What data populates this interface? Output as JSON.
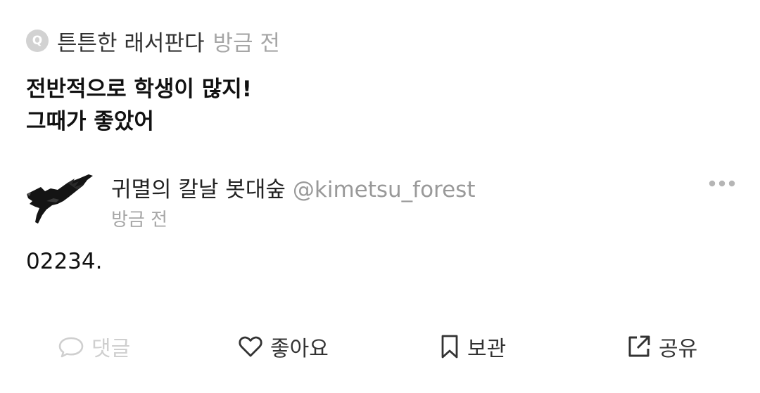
{
  "question": {
    "badge": "Q",
    "asker": "튼튼한 래서판다",
    "time": "방금 전",
    "lines": [
      "전반적으로 학생이 많지!",
      "그때가 좋았어"
    ]
  },
  "answer": {
    "author_name": "귀멸의 칼날 봇대숲",
    "author_handle": "@kimetsu_forest",
    "time": "방금 전",
    "body": "02234.",
    "avatar_icon": "crow-icon"
  },
  "actions": {
    "comment": {
      "label": "댓글",
      "icon": "speech-bubble-icon"
    },
    "like": {
      "label": "좋아요",
      "icon": "heart-icon"
    },
    "save": {
      "label": "보관",
      "icon": "bookmark-icon"
    },
    "share": {
      "label": "공유",
      "icon": "share-icon"
    }
  },
  "colors": {
    "muted": "#a6a6a6",
    "disabled": "#cfcfcf",
    "text": "#111111"
  }
}
